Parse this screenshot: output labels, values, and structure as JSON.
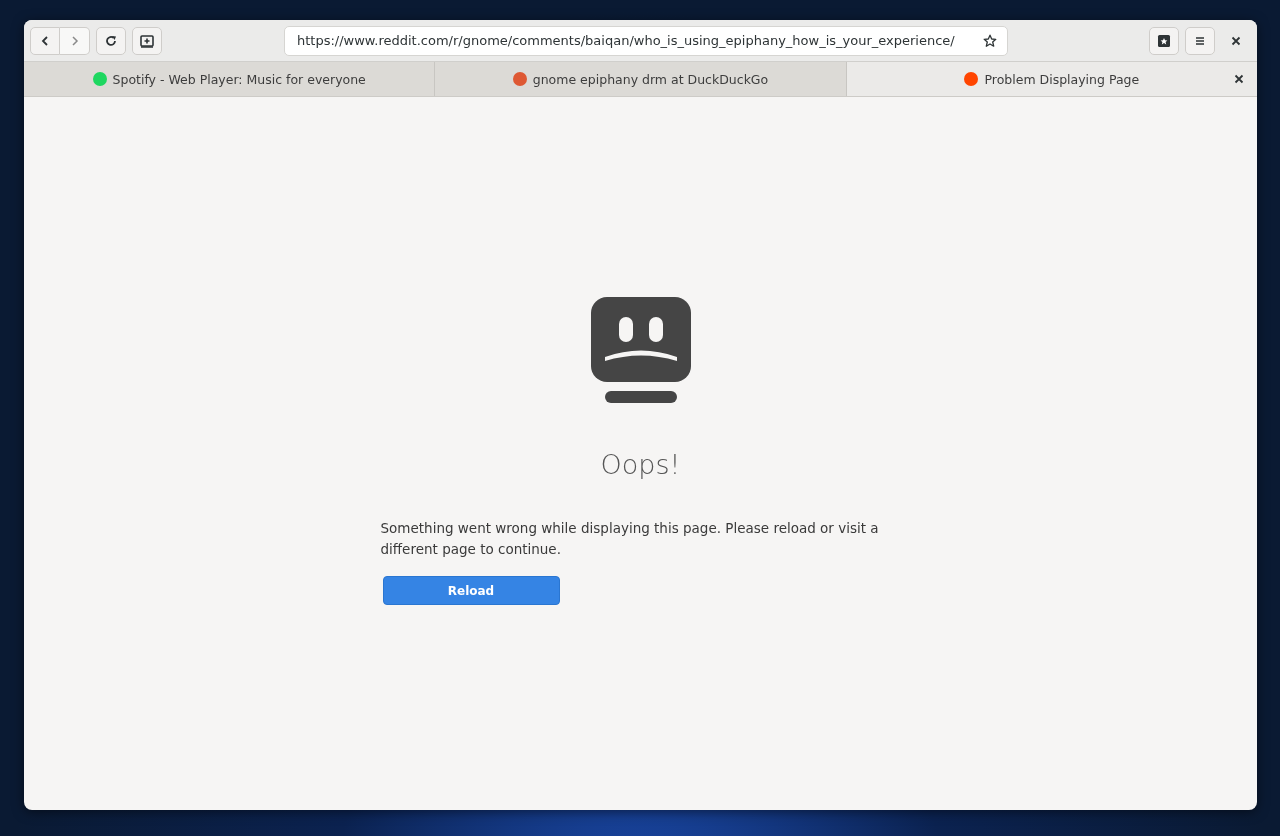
{
  "window": {
    "url": "https://www.reddit.com/r/gnome/comments/baiqan/who_is_using_epiphany_how_is_your_experience/"
  },
  "tabs": [
    {
      "title": "Spotify - Web Player: Music for everyone",
      "color": "#1ed760",
      "selected": false
    },
    {
      "title": "gnome epiphany drm at DuckDuckGo",
      "color": "#de5833",
      "selected": false
    },
    {
      "title": "Problem Displaying Page",
      "color": "#ff4500",
      "selected": true
    }
  ],
  "error_page": {
    "heading": "Oops!",
    "message": "Something went wrong while displaying this page. Please reload or visit a different page to continue.",
    "button": "Reload"
  }
}
